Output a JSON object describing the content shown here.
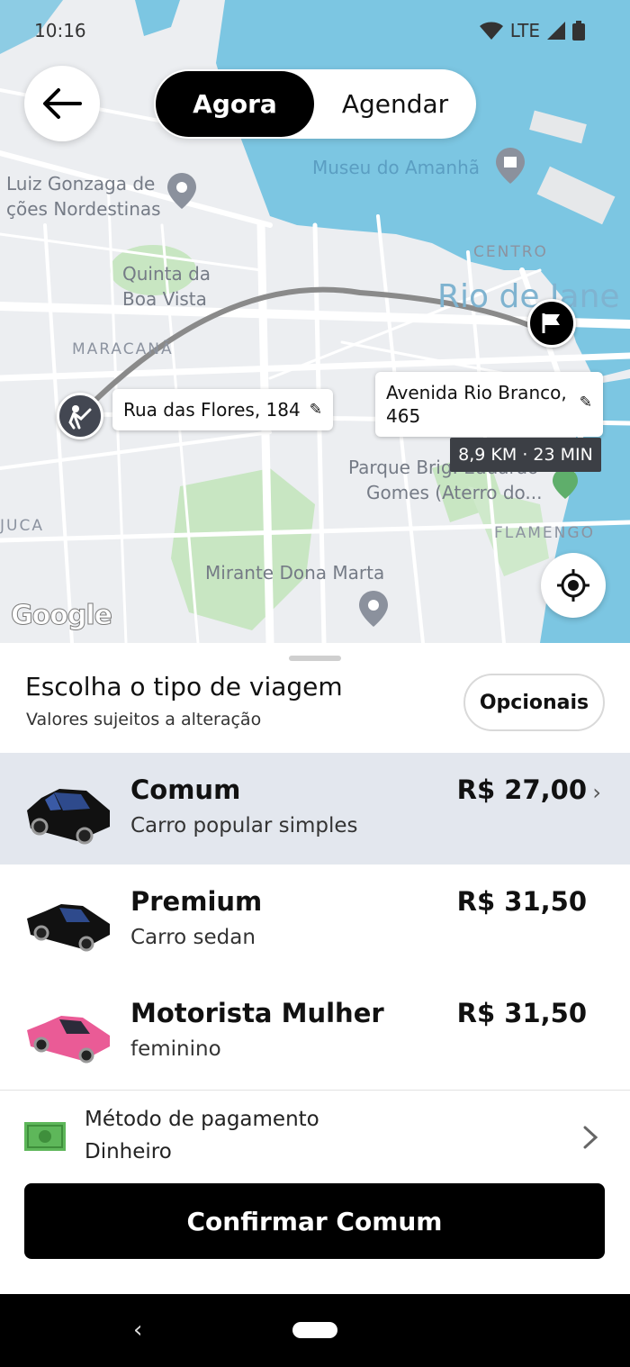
{
  "status_bar": {
    "time": "10:16",
    "network": "LTE",
    "icons": [
      "wifi-icon",
      "signal-icon",
      "battery-icon"
    ]
  },
  "mode_toggle": {
    "active": "Agora",
    "inactive": "Agendar"
  },
  "map": {
    "labels": {
      "museu": "Museu do Amanhã",
      "gonzaga1": "Luiz Gonzaga de",
      "gonzaga2": "ções Nordestinas",
      "centro": "CENTRO",
      "rio": "Rio de Jane",
      "quinta1": "Quinta da",
      "quinta2": "Boa Vista",
      "maracana": "MARACANÃ",
      "parque1": "Parque Brig. Eduardo",
      "parque2": "Gomes (Aterro do...",
      "juca": "JUCA",
      "flamengo": "FLAMENGO",
      "mirante": "Mirante Dona Marta",
      "google": "Google"
    },
    "origin": "Rua das Flores, 184",
    "destination_line1": "Avenida Rio Branco,",
    "destination_line2": "465",
    "eta": "8,9 KM · 23 MIN"
  },
  "sheet": {
    "title": "Escolha o tipo de viagem",
    "subtitle": "Valores sujeitos a alteração",
    "options_button": "Opcionais"
  },
  "rides": [
    {
      "name": "Comum",
      "desc": "Carro popular simples",
      "price": "R$ 27,00",
      "selected": true,
      "color": "#111111"
    },
    {
      "name": "Premium",
      "desc": "Carro sedan",
      "price": "R$ 31,50",
      "selected": false,
      "color": "#111111"
    },
    {
      "name": "Motorista Mulher",
      "desc": "feminino",
      "price": "R$ 31,50",
      "selected": false,
      "color": "#ea5b96"
    }
  ],
  "payment": {
    "label": "Método de pagamento",
    "value": "Dinheiro",
    "icon": "cash-icon"
  },
  "confirm_button": "Confirmar Comum",
  "colors": {
    "water": "#7cc6e2",
    "park": "#c8e6c2",
    "selected_row": "#e3e7ee",
    "route": "#8a8a8a"
  }
}
